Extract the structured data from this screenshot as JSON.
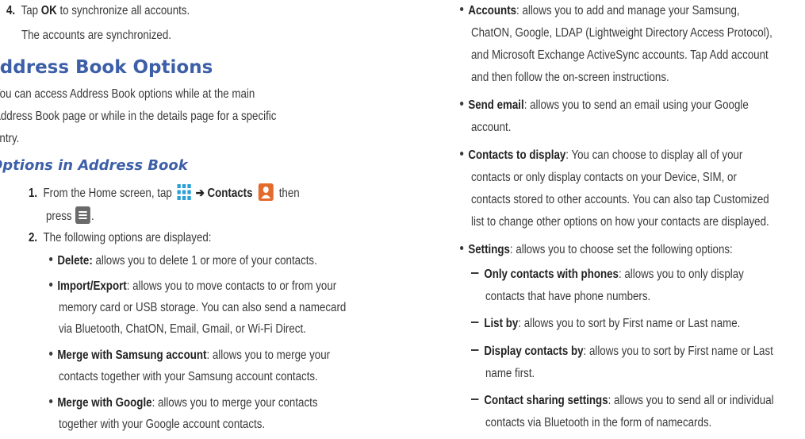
{
  "left": {
    "step4": {
      "num": "4.",
      "pre": "Tap ",
      "bold": "OK",
      "post": " to synchronize all accounts."
    },
    "step4_result": "The accounts are synchronized.",
    "heading": "Address Book Options",
    "intro": [
      "You can access Address Book options while at the main",
      "Address Book page or while in the details page for a specific",
      "entry."
    ],
    "subheading": "Options in Address Book",
    "step1": {
      "num": "1.",
      "pre": "From the Home screen, tap",
      "arrow": "➔",
      "bold": "Contacts",
      "then": "then",
      "press": "press",
      "period": "."
    },
    "step2": {
      "num": "2.",
      "text": "The following options are displayed:"
    },
    "bullets": [
      {
        "bold": "Delete:",
        "lines": [
          " allows you to delete 1 or more of your contacts."
        ]
      },
      {
        "bold": "Import/Export",
        "lines": [
          ": allows you to move contacts to or from your",
          "memory card or USB storage. You can also send a namecard",
          "via Bluetooth, ChatON, Email, Gmail, or Wi-Fi Direct."
        ]
      },
      {
        "bold": "Merge with Samsung account",
        "lines": [
          ": allows you to merge your",
          "contacts together with your Samsung account contacts."
        ]
      },
      {
        "bold": "Merge with Google",
        "lines": [
          ": allows you to merge your contacts",
          "together with your Google account contacts."
        ]
      }
    ]
  },
  "right": {
    "bullets": [
      {
        "bold": "Accounts",
        "lines": [
          ": allows you to add and manage your Samsung,",
          "ChatON, Google, LDAP (Lightweight Directory Access Protocol),",
          "and Microsoft Exchange ActiveSync accounts. Tap Add account",
          "and then follow the on-screen instructions."
        ]
      },
      {
        "bold": "Send email",
        "lines": [
          ": allows you to send an email using your Google",
          "account."
        ]
      },
      {
        "bold": "Contacts to display",
        "lines": [
          ": You can choose to display all of your",
          "contacts or only display contacts on your Device, SIM, or",
          "contacts stored to other accounts. You can also tap Customized",
          "list to change other options on how your contacts are displayed."
        ]
      },
      {
        "bold": "Settings",
        "lines": [
          ": allows you to choose set the following options:"
        ]
      }
    ],
    "dashes": [
      {
        "bold": "Only contacts with phones",
        "lines": [
          ": allows you to only display",
          "contacts that have phone numbers."
        ]
      },
      {
        "bold": "List by",
        "lines": [
          ": allows you to sort by First name or Last name."
        ]
      },
      {
        "bold": "Display contacts by",
        "lines": [
          ": allows you to sort by First name or Last",
          "name first."
        ]
      },
      {
        "bold": "Contact sharing settings",
        "lines": [
          ": allows you to send all or individual",
          "contacts via Bluetooth in the form of namecards."
        ]
      }
    ]
  },
  "icons": {
    "apps": "apps-grid-icon",
    "contacts": "contacts-icon",
    "menu": "menu-icon"
  },
  "colors": {
    "heading": "#3d5fa8",
    "contacts_icon": "#e36b2c",
    "apps_icon": "#2a9fd6"
  }
}
